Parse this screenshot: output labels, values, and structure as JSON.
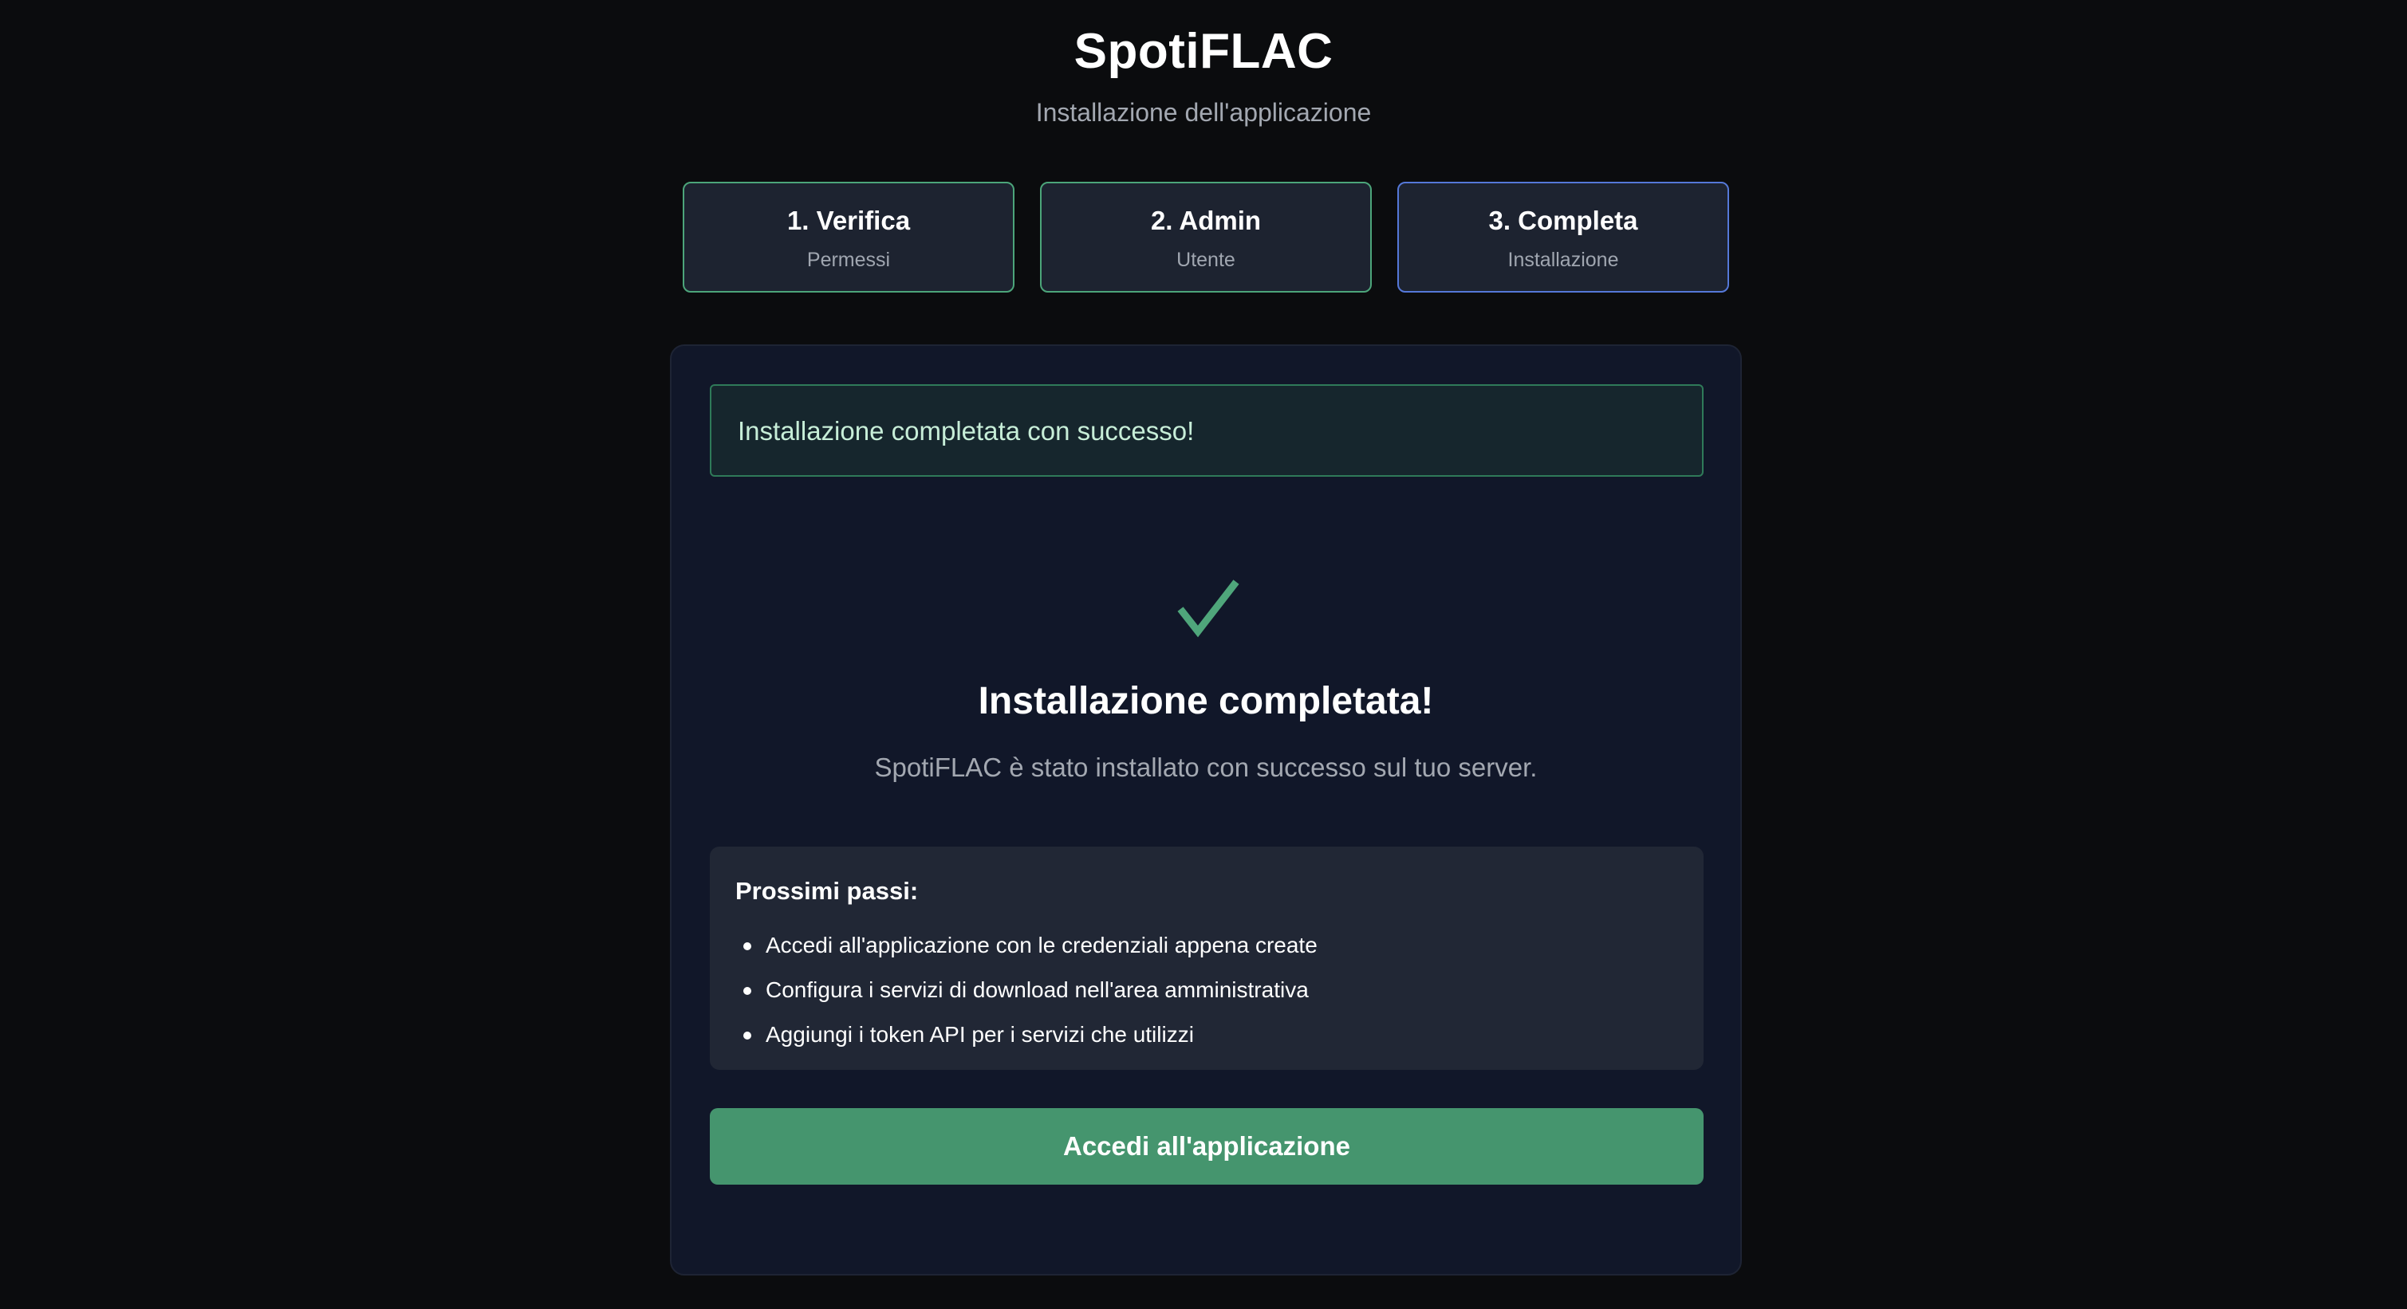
{
  "header": {
    "title": "SpotiFLAC",
    "subtitle": "Installazione dell'applicazione"
  },
  "steps": [
    {
      "title": "1. Verifica",
      "subtitle": "Permessi",
      "status": "completed"
    },
    {
      "title": "2. Admin",
      "subtitle": "Utente",
      "status": "completed"
    },
    {
      "title": "3. Completa",
      "subtitle": "Installazione",
      "status": "active"
    }
  ],
  "alert": {
    "message": "Installazione completata con successo!"
  },
  "completion": {
    "icon": "check-icon",
    "title": "Installazione completata!",
    "description": "SpotiFLAC è stato installato con successo sul tuo server."
  },
  "next_steps": {
    "title": "Prossimi passi:",
    "items": [
      "Accedi all'applicazione con le credenziali appena create",
      "Configura i servizi di download nell'area amministrativa",
      "Aggiungi i token API per i servizi che utilizzi"
    ]
  },
  "cta": {
    "label": "Accedi all'applicazione"
  },
  "colors": {
    "background": "#0b0c0e",
    "card": "#111729",
    "success": "#45956e",
    "success_border": "#4ca57a",
    "active_border": "#5578d8"
  }
}
